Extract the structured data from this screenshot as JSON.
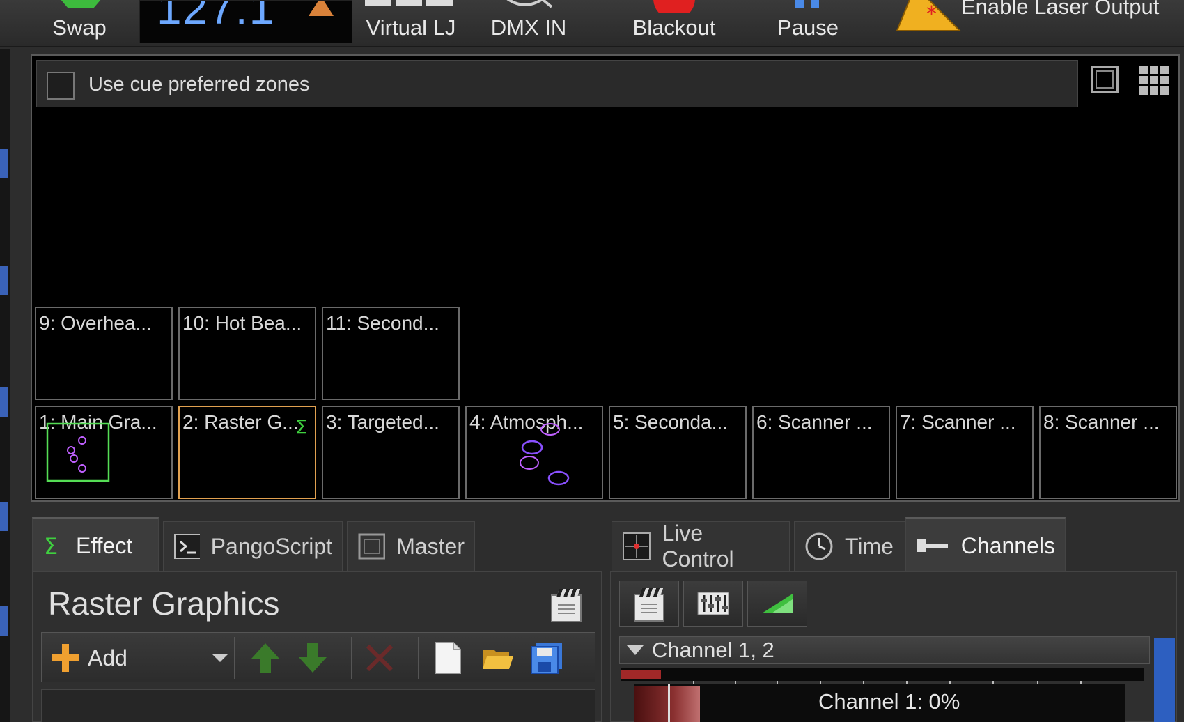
{
  "toolbar": {
    "swap_label": "Swap",
    "bpm_value": "127.1",
    "virtual_lj_label": "Virtual LJ",
    "dmx_in_label": "DMX IN",
    "blackout_label": "Blackout",
    "pause_label": "Pause",
    "enable_laser_label": "Enable Laser Output"
  },
  "zones_panel": {
    "use_cue_preferred_zones_label": "Use cue preferred zones",
    "use_cue_preferred_zones_checked": false,
    "top_row": [
      {
        "label": "9: Overhea..."
      },
      {
        "label": "10: Hot Bea..."
      },
      {
        "label": "11: Second..."
      }
    ],
    "bottom_row": [
      {
        "label": "1: Main Gra..."
      },
      {
        "label": "2: Raster G..."
      },
      {
        "label": "3: Targeted..."
      },
      {
        "label": "4: Atmosph..."
      },
      {
        "label": "5: Seconda..."
      },
      {
        "label": "6: Scanner ..."
      },
      {
        "label": "7: Scanner ..."
      },
      {
        "label": "8: Scanner ..."
      }
    ]
  },
  "left_tabs": [
    {
      "label": "Effect",
      "icon": "sigma-icon",
      "active": true
    },
    {
      "label": "PangoScript",
      "icon": "script-icon",
      "active": false
    },
    {
      "label": "Master",
      "icon": "master-icon",
      "active": false
    }
  ],
  "effect_panel": {
    "title": "Raster Graphics",
    "add_label": "Add"
  },
  "right_tabs": [
    {
      "label": "Live Control",
      "icon": "live-control-icon",
      "active": false
    },
    {
      "label": "Time",
      "icon": "clock-icon",
      "active": false
    },
    {
      "label": "Channels",
      "icon": "channels-icon",
      "active": true
    }
  ],
  "channels_panel": {
    "group_label": "Channel 1, 2",
    "channel_value_label": "Channel 1: 0%"
  },
  "colors": {
    "accent_blue": "#6da8ff",
    "selected_zone_border": "#e0a050",
    "preview_green": "#55dd55",
    "preview_magenta": "#c060ff",
    "channel_red": "#a02828"
  }
}
